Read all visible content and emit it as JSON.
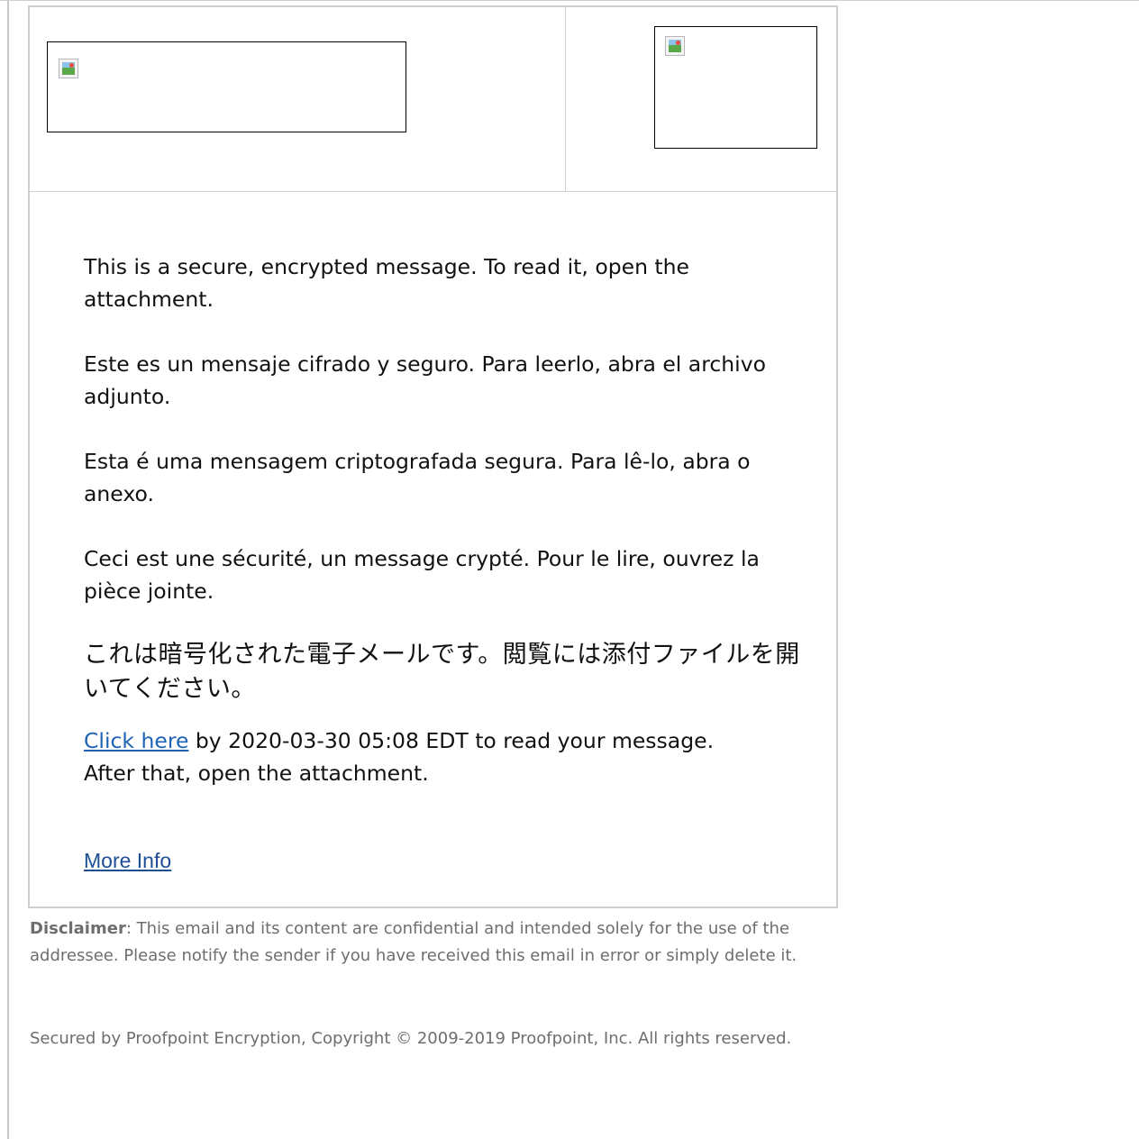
{
  "header": {
    "left_image_alt": "",
    "right_image_alt": ""
  },
  "message": {
    "en": "This is a secure, encrypted message. To read it, open the attachment.",
    "es": "Este es un mensaje cifrado y seguro. Para leerlo, abra el archivo adjunto.",
    "pt": "Esta é uma mensagem criptografada segura. Para lê-lo, abra o anexo.",
    "fr": "Ceci est une sécurité, un message crypté. Pour le lire, ouvrez la pièce jointe.",
    "ja": "これは暗号化された電子メールです。閲覧には添付ファイルを開いてください。",
    "cta_link": "Click here",
    "cta_rest": " by 2020-03-30 05:08 EDT to read your message.",
    "cta_line2": "After that, open the attachment.",
    "more_info": "More Info"
  },
  "footer": {
    "disclaimer_label": "Disclaimer",
    "disclaimer_text": ": This email and its content are confidential and intended solely for the use of the addressee. Please notify the sender if you have received this email in error or simply delete it.",
    "copyright": "Secured by Proofpoint Encryption, Copyright © 2009-2019 Proofpoint, Inc. All rights reserved."
  },
  "colors": {
    "link": "#1e63b5",
    "more_info_link": "#1e4f95",
    "footer_text": "#6e6e6e",
    "card_border": "#cfcfcf"
  },
  "icons": [
    "broken-image-icon"
  ]
}
